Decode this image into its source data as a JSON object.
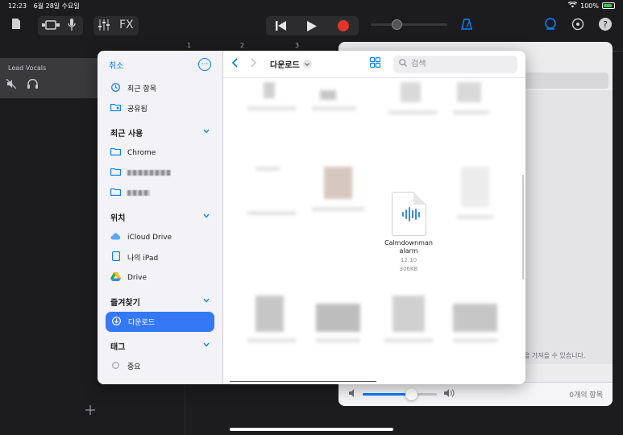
{
  "status_bar": {
    "time": "12:23",
    "date": "6월 28일 수요일",
    "battery": "100%"
  },
  "toolbar": {
    "fx_label": "FX"
  },
  "ruler": {
    "marks": [
      "1",
      "2",
      "3"
    ]
  },
  "track": {
    "name": "Lead Vocals"
  },
  "picker": {
    "cancel_label": "취소",
    "more_label": "···",
    "sidebar": {
      "top_items": [
        {
          "label": "최근 항목",
          "icon": "clock-icon"
        },
        {
          "label": "공유됨",
          "icon": "shared-folder-icon"
        }
      ],
      "sections": {
        "recent_title": "최근 사용",
        "recent_items": [
          {
            "label": "Chrome"
          }
        ],
        "locations_title": "위치",
        "locations": [
          {
            "label": "iCloud Drive",
            "icon": "icloud-icon"
          },
          {
            "label": "나의 iPad",
            "icon": "ipad-icon"
          },
          {
            "label": "Drive",
            "icon": "google-drive-icon"
          }
        ],
        "favorites_title": "즐겨찾기",
        "favorites": [
          {
            "label": "다운로드",
            "icon": "download-icon"
          }
        ],
        "tags_title": "태그",
        "tags": [
          {
            "label": "중요"
          }
        ]
      }
    },
    "folder_title": "다운로드",
    "search_placeholder": "검색",
    "file": {
      "name_line1": "Calmdownman",
      "name_line2": "alarm",
      "time": "12:10",
      "size": "306KB"
    }
  },
  "back_sheet": {
    "message": "을 가져올 수 있습니다.",
    "item_count": "0개의 항목",
    "volume_level": 0.65
  }
}
